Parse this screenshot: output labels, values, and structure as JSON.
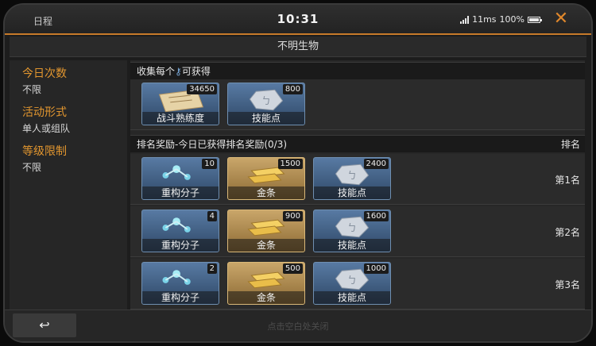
{
  "topbar": {
    "left_label": "日程",
    "time": "10:31",
    "latency": "11ms",
    "battery": "100%"
  },
  "title": "不明生物",
  "info": [
    {
      "label": "今日次数",
      "value": "不限"
    },
    {
      "label": "活动形式",
      "value": "单人或组队"
    },
    {
      "label": "等级限制",
      "value": "不限"
    }
  ],
  "collect": {
    "header_pre": "收集每个",
    "header_post": "可获得",
    "items": [
      {
        "name": "战斗熟练度",
        "count": "34650",
        "style": "blue",
        "icon": "scroll-icon"
      },
      {
        "name": "技能点",
        "count": "800",
        "style": "blue",
        "icon": "skill-stone-icon"
      }
    ]
  },
  "ranking": {
    "header": "排名奖励-今日已获得排名奖励(0/3)",
    "rank_col": "排名",
    "rows": [
      {
        "place": "第1名",
        "items": [
          {
            "name": "重构分子",
            "count": "10",
            "style": "blue",
            "icon": "molecule-icon"
          },
          {
            "name": "金条",
            "count": "1500",
            "style": "gold",
            "icon": "gold-bar-icon"
          },
          {
            "name": "技能点",
            "count": "2400",
            "style": "blue",
            "icon": "skill-stone-icon"
          }
        ]
      },
      {
        "place": "第2名",
        "items": [
          {
            "name": "重构分子",
            "count": "4",
            "style": "blue",
            "icon": "molecule-icon"
          },
          {
            "name": "金条",
            "count": "900",
            "style": "gold",
            "icon": "gold-bar-icon"
          },
          {
            "name": "技能点",
            "count": "1600",
            "style": "blue",
            "icon": "skill-stone-icon"
          }
        ]
      },
      {
        "place": "第3名",
        "items": [
          {
            "name": "重构分子",
            "count": "2",
            "style": "blue",
            "icon": "molecule-icon"
          },
          {
            "name": "金条",
            "count": "500",
            "style": "gold",
            "icon": "gold-bar-icon"
          },
          {
            "name": "技能点",
            "count": "1000",
            "style": "blue",
            "icon": "skill-stone-icon"
          }
        ]
      }
    ]
  },
  "bottom": {
    "back_icon": "↩",
    "hint": "点击空白处关闭"
  },
  "colors": {
    "accent": "#e0872b",
    "label": "#e2962f"
  }
}
